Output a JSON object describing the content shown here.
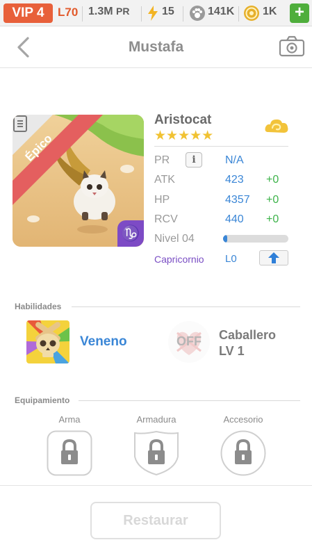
{
  "status_bar": {
    "vip": "VIP 4",
    "level": "L70",
    "power": "1.3M",
    "power_unit": "PR",
    "energy": "15",
    "paws": "141K",
    "coins": "1K",
    "add": "+"
  },
  "header": {
    "title": "Mustafa",
    "back_icon": "chevron-left-icon",
    "camera_icon": "camera-icon"
  },
  "pet": {
    "rarity": "Épico",
    "zodiac_symbol": "♑",
    "name": "Aristocat",
    "stars": "★★★★★",
    "stats": [
      {
        "label": "PR",
        "value": "N/A",
        "bonus": ""
      },
      {
        "label": "ATK",
        "value": "423",
        "bonus": "+0"
      },
      {
        "label": "HP",
        "value": "4357",
        "bonus": "+0"
      },
      {
        "label": "RCV",
        "value": "440",
        "bonus": "+0"
      }
    ],
    "info": "i",
    "level_label": "Nivel 04",
    "level_progress": 0.03,
    "zodiac_name": "Capricornio",
    "zodiac_level": "L0"
  },
  "skills": {
    "section_title": "Habilidades",
    "skill1": "Veneno",
    "skill2_state": "OFF",
    "skill2_name": "Caballero",
    "skill2_level": "LV 1"
  },
  "equipment": {
    "section_title": "Equipamiento",
    "slots": [
      "Arma",
      "Armadura",
      "Accesorio"
    ]
  },
  "footer": {
    "restore": "Restaurar"
  },
  "colors": {
    "accent_blue": "#3a86d6",
    "bonus_green": "#3db34a",
    "vip_orange": "#e8603a",
    "zodiac_purple": "#7d4bc5",
    "epic_red": "#e45f5f"
  }
}
